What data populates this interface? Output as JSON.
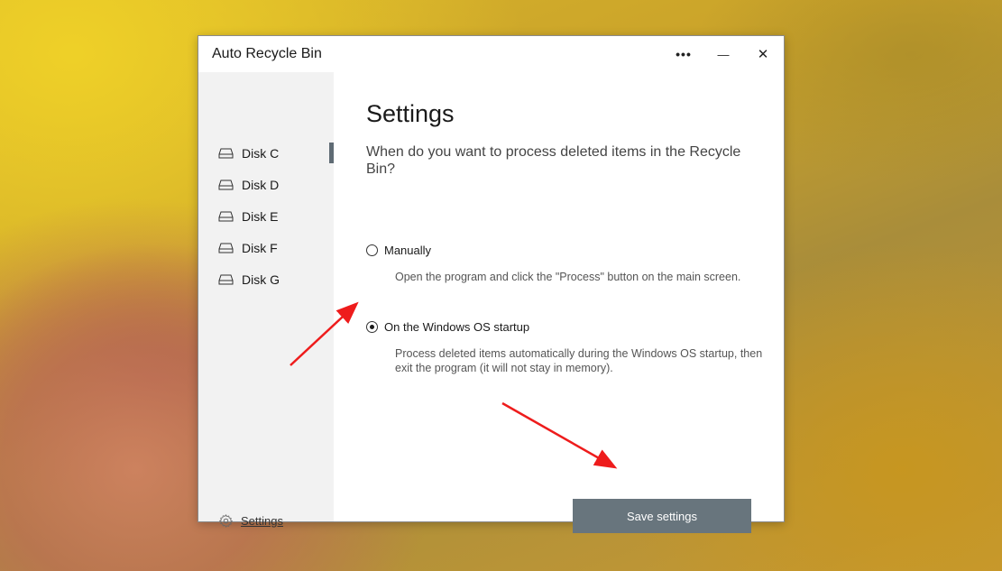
{
  "window": {
    "title": "Auto Recycle Bin",
    "more_glyph": "•••",
    "min_glyph": "—",
    "close_glyph": "✕"
  },
  "sidebar": {
    "disks": [
      {
        "label": "Disk C",
        "icon": "drive-icon",
        "active": true
      },
      {
        "label": "Disk D",
        "icon": "drive-icon",
        "active": false
      },
      {
        "label": "Disk E",
        "icon": "drive-icon",
        "active": false
      },
      {
        "label": "Disk F",
        "icon": "drive-icon",
        "active": false
      },
      {
        "label": "Disk G",
        "icon": "drive-icon",
        "active": false
      }
    ],
    "settings_label": "Settings",
    "settings_icon": "gear-icon"
  },
  "main": {
    "heading": "Settings",
    "question": "When do you want to process deleted items in the Recycle Bin?",
    "options": [
      {
        "label": "Manually",
        "description": "Open the program and click the \"Process\" button on the main screen.",
        "selected": false
      },
      {
        "label": "On the Windows OS startup",
        "description": "Process deleted items automatically during the Windows OS startup, then exit the program (it will not stay in memory).",
        "selected": true
      }
    ],
    "save_label": "Save settings"
  },
  "colors": {
    "accent": "#5f6b74",
    "button": "#68757d",
    "annotation_arrow": "#ee1c1c"
  }
}
